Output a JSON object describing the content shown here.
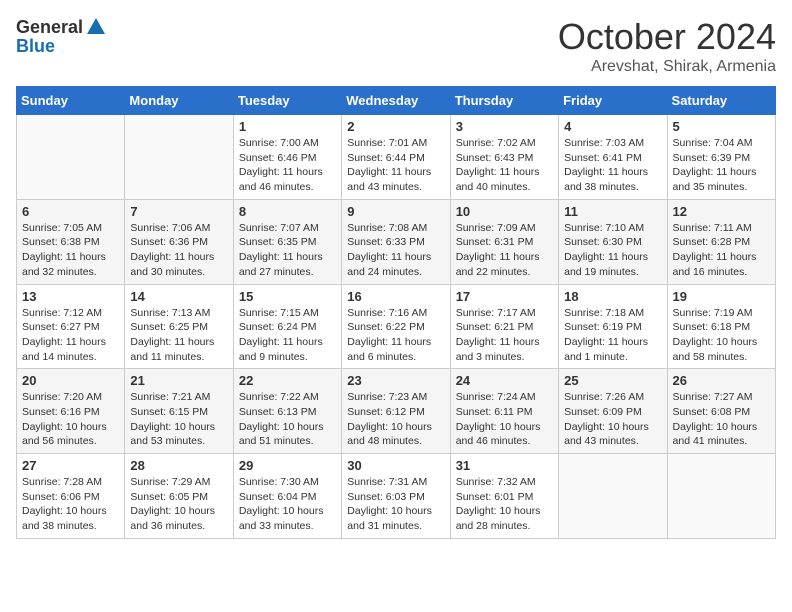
{
  "header": {
    "logo_general": "General",
    "logo_blue": "Blue",
    "title": "October 2024",
    "location": "Arevshat, Shirak, Armenia"
  },
  "weekdays": [
    "Sunday",
    "Monday",
    "Tuesday",
    "Wednesday",
    "Thursday",
    "Friday",
    "Saturday"
  ],
  "weeks": [
    [
      {
        "day": "",
        "info": ""
      },
      {
        "day": "",
        "info": ""
      },
      {
        "day": "1",
        "info": "Sunrise: 7:00 AM\nSunset: 6:46 PM\nDaylight: 11 hours and 46 minutes."
      },
      {
        "day": "2",
        "info": "Sunrise: 7:01 AM\nSunset: 6:44 PM\nDaylight: 11 hours and 43 minutes."
      },
      {
        "day": "3",
        "info": "Sunrise: 7:02 AM\nSunset: 6:43 PM\nDaylight: 11 hours and 40 minutes."
      },
      {
        "day": "4",
        "info": "Sunrise: 7:03 AM\nSunset: 6:41 PM\nDaylight: 11 hours and 38 minutes."
      },
      {
        "day": "5",
        "info": "Sunrise: 7:04 AM\nSunset: 6:39 PM\nDaylight: 11 hours and 35 minutes."
      }
    ],
    [
      {
        "day": "6",
        "info": "Sunrise: 7:05 AM\nSunset: 6:38 PM\nDaylight: 11 hours and 32 minutes."
      },
      {
        "day": "7",
        "info": "Sunrise: 7:06 AM\nSunset: 6:36 PM\nDaylight: 11 hours and 30 minutes."
      },
      {
        "day": "8",
        "info": "Sunrise: 7:07 AM\nSunset: 6:35 PM\nDaylight: 11 hours and 27 minutes."
      },
      {
        "day": "9",
        "info": "Sunrise: 7:08 AM\nSunset: 6:33 PM\nDaylight: 11 hours and 24 minutes."
      },
      {
        "day": "10",
        "info": "Sunrise: 7:09 AM\nSunset: 6:31 PM\nDaylight: 11 hours and 22 minutes."
      },
      {
        "day": "11",
        "info": "Sunrise: 7:10 AM\nSunset: 6:30 PM\nDaylight: 11 hours and 19 minutes."
      },
      {
        "day": "12",
        "info": "Sunrise: 7:11 AM\nSunset: 6:28 PM\nDaylight: 11 hours and 16 minutes."
      }
    ],
    [
      {
        "day": "13",
        "info": "Sunrise: 7:12 AM\nSunset: 6:27 PM\nDaylight: 11 hours and 14 minutes."
      },
      {
        "day": "14",
        "info": "Sunrise: 7:13 AM\nSunset: 6:25 PM\nDaylight: 11 hours and 11 minutes."
      },
      {
        "day": "15",
        "info": "Sunrise: 7:15 AM\nSunset: 6:24 PM\nDaylight: 11 hours and 9 minutes."
      },
      {
        "day": "16",
        "info": "Sunrise: 7:16 AM\nSunset: 6:22 PM\nDaylight: 11 hours and 6 minutes."
      },
      {
        "day": "17",
        "info": "Sunrise: 7:17 AM\nSunset: 6:21 PM\nDaylight: 11 hours and 3 minutes."
      },
      {
        "day": "18",
        "info": "Sunrise: 7:18 AM\nSunset: 6:19 PM\nDaylight: 11 hours and 1 minute."
      },
      {
        "day": "19",
        "info": "Sunrise: 7:19 AM\nSunset: 6:18 PM\nDaylight: 10 hours and 58 minutes."
      }
    ],
    [
      {
        "day": "20",
        "info": "Sunrise: 7:20 AM\nSunset: 6:16 PM\nDaylight: 10 hours and 56 minutes."
      },
      {
        "day": "21",
        "info": "Sunrise: 7:21 AM\nSunset: 6:15 PM\nDaylight: 10 hours and 53 minutes."
      },
      {
        "day": "22",
        "info": "Sunrise: 7:22 AM\nSunset: 6:13 PM\nDaylight: 10 hours and 51 minutes."
      },
      {
        "day": "23",
        "info": "Sunrise: 7:23 AM\nSunset: 6:12 PM\nDaylight: 10 hours and 48 minutes."
      },
      {
        "day": "24",
        "info": "Sunrise: 7:24 AM\nSunset: 6:11 PM\nDaylight: 10 hours and 46 minutes."
      },
      {
        "day": "25",
        "info": "Sunrise: 7:26 AM\nSunset: 6:09 PM\nDaylight: 10 hours and 43 minutes."
      },
      {
        "day": "26",
        "info": "Sunrise: 7:27 AM\nSunset: 6:08 PM\nDaylight: 10 hours and 41 minutes."
      }
    ],
    [
      {
        "day": "27",
        "info": "Sunrise: 7:28 AM\nSunset: 6:06 PM\nDaylight: 10 hours and 38 minutes."
      },
      {
        "day": "28",
        "info": "Sunrise: 7:29 AM\nSunset: 6:05 PM\nDaylight: 10 hours and 36 minutes."
      },
      {
        "day": "29",
        "info": "Sunrise: 7:30 AM\nSunset: 6:04 PM\nDaylight: 10 hours and 33 minutes."
      },
      {
        "day": "30",
        "info": "Sunrise: 7:31 AM\nSunset: 6:03 PM\nDaylight: 10 hours and 31 minutes."
      },
      {
        "day": "31",
        "info": "Sunrise: 7:32 AM\nSunset: 6:01 PM\nDaylight: 10 hours and 28 minutes."
      },
      {
        "day": "",
        "info": ""
      },
      {
        "day": "",
        "info": ""
      }
    ]
  ]
}
